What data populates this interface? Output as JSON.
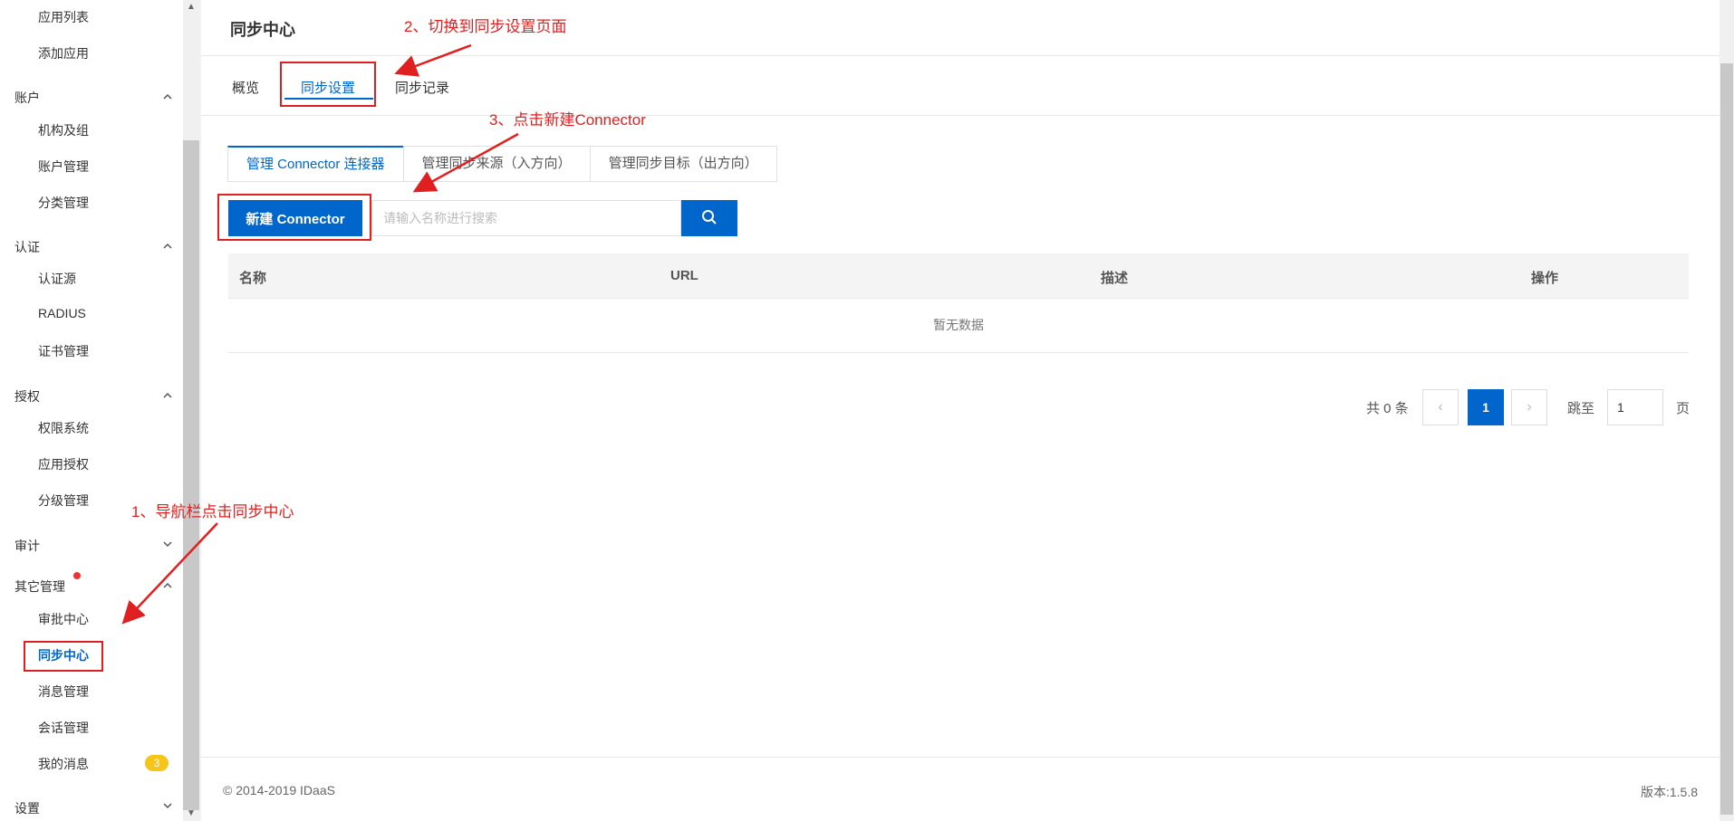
{
  "sidebar": {
    "top_items": [
      "应用列表",
      "添加应用"
    ],
    "groups": [
      {
        "title": "账户",
        "items": [
          "机构及组",
          "账户管理",
          "分类管理"
        ]
      },
      {
        "title": "认证",
        "items": [
          "认证源",
          "RADIUS",
          "证书管理"
        ]
      },
      {
        "title": "授权",
        "items": [
          "权限系统",
          "应用授权",
          "分级管理"
        ]
      },
      {
        "title": "审计",
        "items": []
      },
      {
        "title": "其它管理",
        "items": [
          "审批中心",
          "同步中心",
          "消息管理",
          "会话管理",
          "我的消息"
        ]
      },
      {
        "title": "设置",
        "items": []
      }
    ],
    "active_item": "同步中心",
    "badge_count": "3"
  },
  "header": {
    "title": "同步中心"
  },
  "tabs": [
    "概览",
    "同步设置",
    "同步记录"
  ],
  "active_tab": "同步设置",
  "subtabs": [
    "管理 Connector 连接器",
    "管理同步来源（入方向）",
    "管理同步目标（出方向）"
  ],
  "toolbar": {
    "new_button": "新建 Connector",
    "search_placeholder": "请输入名称进行搜索"
  },
  "table": {
    "columns": [
      "名称",
      "URL",
      "描述",
      "操作"
    ],
    "empty_text": "暂无数据"
  },
  "pagination": {
    "total_text": "共 0 条",
    "current_page": "1",
    "jump_label": "跳至",
    "jump_value": "1",
    "page_unit": "页"
  },
  "footer": {
    "copyright": "© 2014-2019 IDaaS",
    "version": "版本:1.5.8"
  },
  "annotations": {
    "step1": "1、导航栏点击同步中心",
    "step2": "2、切换到同步设置页面",
    "step3": "3、点击新建Connector"
  },
  "colors": {
    "primary": "#0066cc",
    "annotation": "#e02020",
    "badge": "#f5c518"
  }
}
